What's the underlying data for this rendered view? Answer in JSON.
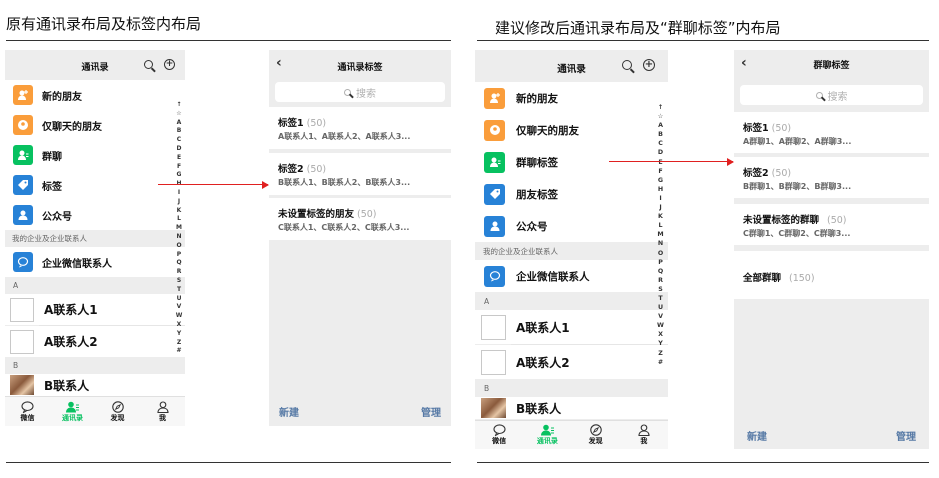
{
  "headings": {
    "left": "原有通讯录布局及标签内布局",
    "right": "建议修改后通讯录布局及“群聊标签”内布局"
  },
  "colors": {
    "orange": "#fa9d3b",
    "green": "#07c160",
    "blue": "#2782d7",
    "link": "#577aa6",
    "arrow": "#e02020"
  },
  "old_contacts": {
    "title": "通讯录",
    "header_icons": [
      "search-icon",
      "plus-circle-icon"
    ],
    "rows": [
      {
        "label": "新的朋友",
        "icon": "add-friend-icon",
        "color": "#fa9d3b"
      },
      {
        "label": "仅聊天的朋友",
        "icon": "chat-only-icon",
        "color": "#fa9d3b"
      },
      {
        "label": "群聊",
        "icon": "group-chat-icon",
        "color": "#07c160"
      },
      {
        "label": "标签",
        "icon": "tag-icon",
        "color": "#2782d7"
      },
      {
        "label": "公众号",
        "icon": "official-account-icon",
        "color": "#2782d7"
      }
    ],
    "enterprise_section": "我的企业及企业联系人",
    "enterprise_row": "企业微信联系人",
    "section_a": "A",
    "contacts_a": [
      "A联系人1",
      "A联系人2"
    ],
    "section_b": "B",
    "contacts_b": [
      "B联系人"
    ]
  },
  "new_contacts": {
    "title": "通讯录",
    "rows": [
      {
        "label": "新的朋友",
        "icon": "add-friend-icon",
        "color": "#fa9d3b"
      },
      {
        "label": "仅聊天的朋友",
        "icon": "chat-only-icon",
        "color": "#fa9d3b"
      },
      {
        "label": "群聊标签",
        "icon": "group-tag-icon",
        "color": "#07c160"
      },
      {
        "label": "朋友标签",
        "icon": "tag-icon",
        "color": "#2782d7"
      },
      {
        "label": "公众号",
        "icon": "official-account-icon",
        "color": "#2782d7"
      }
    ],
    "enterprise_section": "我的企业及企业联系人",
    "enterprise_row": "企业微信联系人",
    "section_a": "A",
    "contacts_a": [
      "A联系人1",
      "A联系人2"
    ],
    "section_b": "B",
    "contacts_b": [
      "B联系人"
    ]
  },
  "alphabet": [
    "↑",
    "☆",
    "A",
    "B",
    "C",
    "D",
    "E",
    "F",
    "G",
    "H",
    "I",
    "J",
    "K",
    "L",
    "M",
    "N",
    "O",
    "P",
    "Q",
    "R",
    "S",
    "T",
    "U",
    "V",
    "W",
    "X",
    "Y",
    "Z",
    "#"
  ],
  "tabbar": [
    {
      "label": "微信",
      "icon": "chat-bubble-icon",
      "active": false
    },
    {
      "label": "通讯录",
      "icon": "contacts-icon",
      "active": true
    },
    {
      "label": "发现",
      "icon": "compass-icon",
      "active": false
    },
    {
      "label": "我",
      "icon": "person-icon",
      "active": false
    }
  ],
  "tags_screen": {
    "title": "通讯录标签",
    "search_placeholder": "搜索",
    "tags": [
      {
        "name": "标签1",
        "count": "(50)",
        "members": "A联系人1、A联系人2、A联系人3..."
      },
      {
        "name": "标签2",
        "count": "(50)",
        "members": "B联系人1、B联系人2、B联系人3..."
      },
      {
        "name": "未设置标签的朋友",
        "count": "(50)",
        "members": "C联系人1、C联系人2、C联系人3..."
      }
    ],
    "new_label": "新建",
    "manage_label": "管理"
  },
  "group_tags_screen": {
    "title": "群聊标签",
    "search_placeholder": "搜索",
    "tags": [
      {
        "name": "标签1",
        "count": "(50)",
        "members": "A群聊1、A群聊2、A群聊3..."
      },
      {
        "name": "标签2",
        "count": "(50)",
        "members": "B群聊1、B群聊2、B群聊3..."
      },
      {
        "name": "未设置标签的群聊",
        "count": "(50)",
        "members": "C群聊1、C群聊2、C群聊3..."
      }
    ],
    "all_groups": {
      "name": "全部群聊",
      "count": "(150)"
    },
    "new_label": "新建",
    "manage_label": "管理"
  }
}
